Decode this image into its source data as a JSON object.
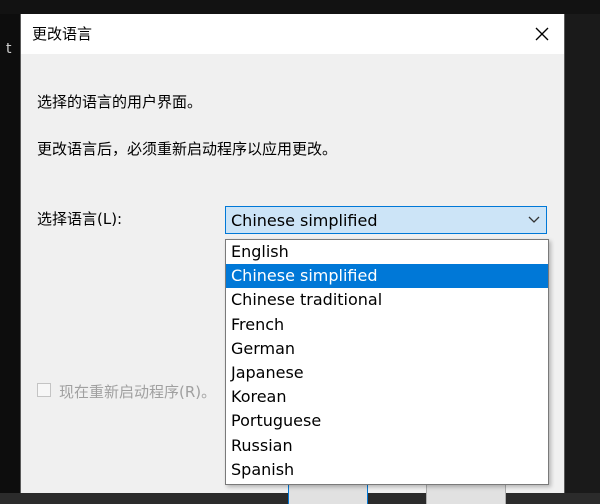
{
  "background": {
    "left_char": "t"
  },
  "dialog": {
    "title": "更改语言",
    "description_line1": "选择的语言的用户界面。",
    "description_line2": "更改语言后，必须重新启动程序以应用更改。",
    "language_label": "选择语言(L):",
    "selected_language": "Chinese simplified",
    "restart_label": "现在重新启动程序(R)。",
    "languages": [
      "English",
      "Chinese simplified",
      "Chinese traditional",
      "French",
      "German",
      "Japanese",
      "Korean",
      "Portuguese",
      "Russian",
      "Spanish"
    ],
    "highlighted_index": 1
  },
  "colors": {
    "accent": "#0078d7",
    "combo_bg": "#cce4f7",
    "dialog_bg": "#f0f0f0",
    "disabled_text": "#a0a0a0"
  },
  "icons": {
    "close": "close-icon",
    "dropdown_arrow": "chevron-down-icon"
  }
}
